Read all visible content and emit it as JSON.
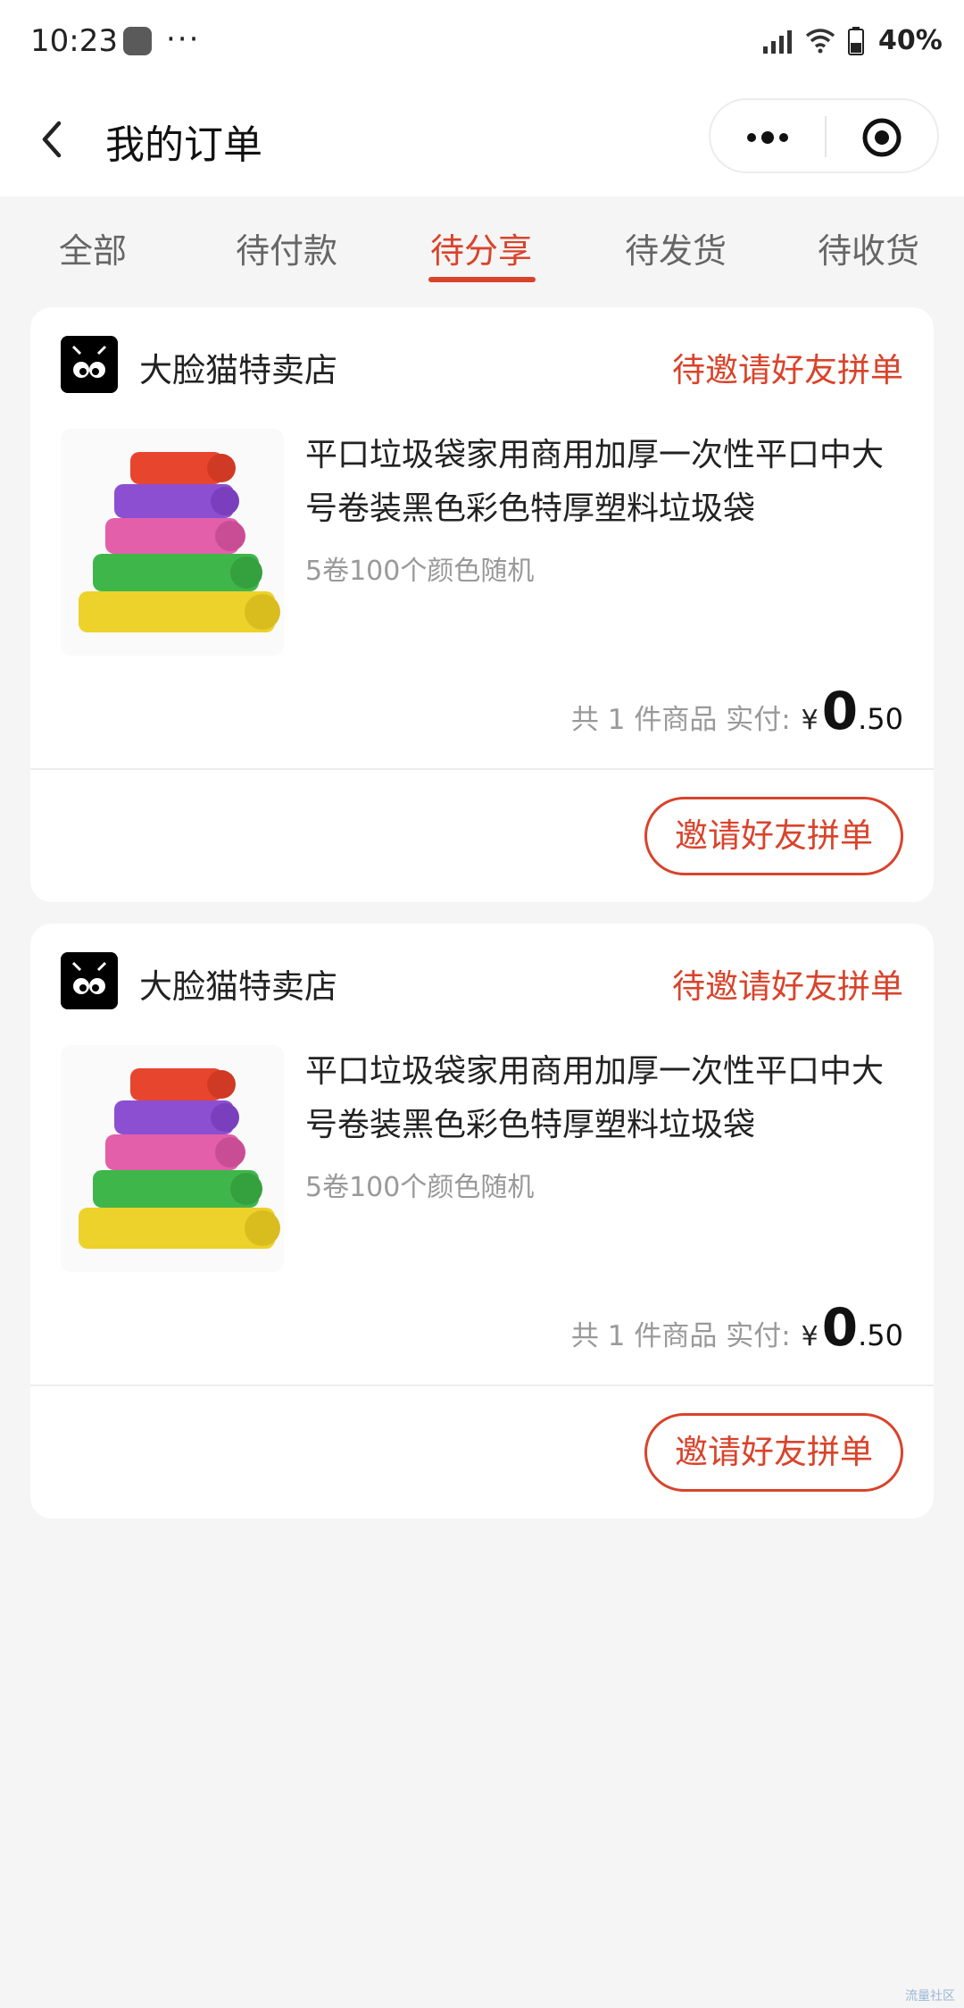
{
  "status_bar": {
    "time": "10:23",
    "app_icon": "gallery-icon",
    "more": "···",
    "battery_text": "40%"
  },
  "nav": {
    "title": "我的订单",
    "back_icon": "chevron-left-icon",
    "more_icon": "more-dots-icon",
    "close_icon": "target-close-icon"
  },
  "tabs": [
    {
      "label": "全部"
    },
    {
      "label": "待付款"
    },
    {
      "label": "待分享",
      "active": true
    },
    {
      "label": "待发货"
    },
    {
      "label": "待收货"
    }
  ],
  "orders": [
    {
      "shop_name": "大脸猫特卖店",
      "status": "待邀请好友拼单",
      "product_title": "平口垃圾袋家用商用加厚一次性平口中大号卷装黑色彩色特厚塑料垃圾袋",
      "product_spec": "5卷100个颜色随机",
      "summary": "共 1 件商品 实付:",
      "currency": "¥",
      "price_int": "0",
      "price_dec": ".50",
      "action_label": "邀请好友拼单"
    },
    {
      "shop_name": "大脸猫特卖店",
      "status": "待邀请好友拼单",
      "product_title": "平口垃圾袋家用商用加厚一次性平口中大号卷装黑色彩色特厚塑料垃圾袋",
      "product_spec": "5卷100个颜色随机",
      "summary": "共 1 件商品 实付:",
      "currency": "¥",
      "price_int": "0",
      "price_dec": ".50",
      "action_label": "邀请好友拼单"
    }
  ],
  "colors": {
    "accent": "#d9432b",
    "background": "#f5f5f5",
    "card": "#ffffff"
  },
  "watermark": "流量社区"
}
